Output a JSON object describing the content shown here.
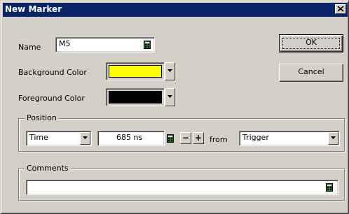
{
  "dialog": {
    "title": "New Marker",
    "close_glyph": "×"
  },
  "name": {
    "label": "Name",
    "value": "M5"
  },
  "background_color": {
    "label": "Background Color",
    "color": "#ffff00"
  },
  "foreground_color": {
    "label": "Foreground Color",
    "color": "#000000"
  },
  "buttons": {
    "ok": "OK",
    "cancel": "Cancel"
  },
  "position": {
    "group_label": "Position",
    "type_value": "Time",
    "offset_value": "685 ns",
    "decrement": "−",
    "increment": "+",
    "from_label": "from",
    "reference_value": "Trigger"
  },
  "comments": {
    "group_label": "Comments",
    "value": ""
  }
}
